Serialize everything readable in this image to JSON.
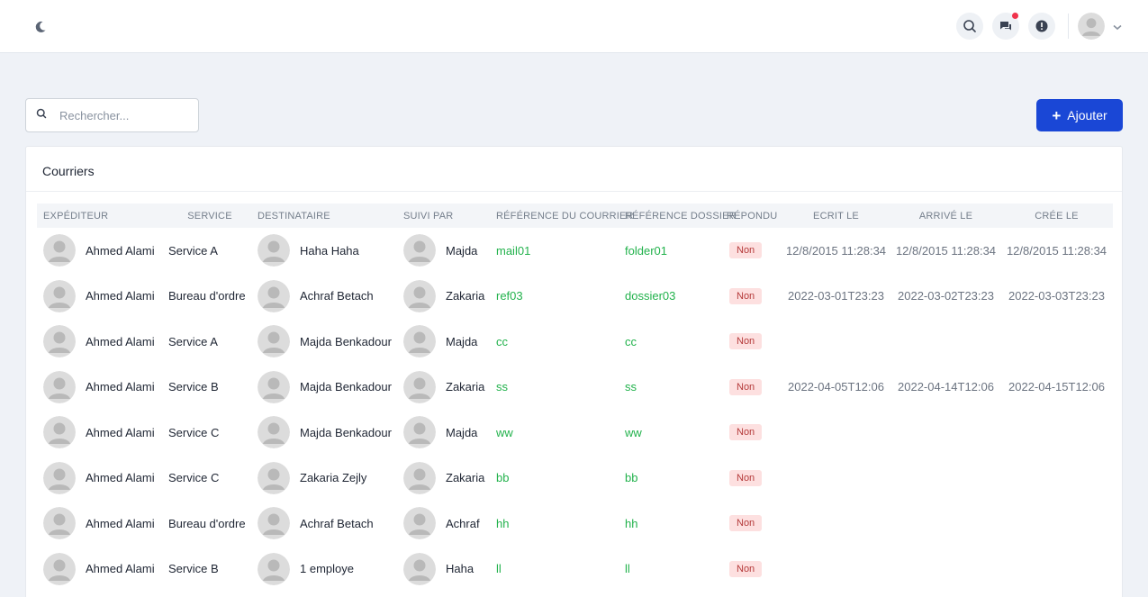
{
  "search": {
    "placeholder": "Rechercher..."
  },
  "add_button": {
    "label": "Ajouter"
  },
  "card": {
    "title": "Courriers"
  },
  "colors": {
    "accent": "#1a47d6",
    "link_green": "#22b24c",
    "badge_bg": "#fde0e0",
    "badge_text": "#b53b3b"
  },
  "table": {
    "headers": {
      "expediteur": "EXPÉDITEUR",
      "service": "SERVICE",
      "destinataire": "DESTINATAIRE",
      "suivi_par": "SUIVI PAR",
      "ref_courrier": "RÉFÉRENCE DU COURRIER",
      "ref_dossier": "RÉFÉRENCE DOSSIER",
      "repondu": "RÉPONDU",
      "ecrit_le": "ECRIT LE",
      "arrive_le": "ARRIVÉ LE",
      "cree_le": "CRÉE LE"
    },
    "rows": [
      {
        "expediteur": "Ahmed Alami",
        "service": "Service A",
        "destinataire": "Haha Haha",
        "suivi_par": "Majda",
        "ref_courrier": "mail01",
        "ref_dossier": "folder01",
        "repondu": "Non",
        "ecrit_le": "12/8/2015 11:28:34",
        "arrive_le": "12/8/2015 11:28:34",
        "cree_le": "12/8/2015 11:28:34"
      },
      {
        "expediteur": "Ahmed Alami",
        "service": "Bureau d'ordre",
        "destinataire": "Achraf Betach",
        "suivi_par": "Zakaria",
        "ref_courrier": "ref03",
        "ref_dossier": "dossier03",
        "repondu": "Non",
        "ecrit_le": "2022-03-01T23:23",
        "arrive_le": "2022-03-02T23:23",
        "cree_le": "2022-03-03T23:23"
      },
      {
        "expediteur": "Ahmed Alami",
        "service": "Service A",
        "destinataire": "Majda Benkadour",
        "suivi_par": "Majda",
        "ref_courrier": "cc",
        "ref_dossier": "cc",
        "repondu": "Non",
        "ecrit_le": "",
        "arrive_le": "",
        "cree_le": ""
      },
      {
        "expediteur": "Ahmed Alami",
        "service": "Service B",
        "destinataire": "Majda Benkadour",
        "suivi_par": "Zakaria",
        "ref_courrier": "ss",
        "ref_dossier": "ss",
        "repondu": "Non",
        "ecrit_le": "2022-04-05T12:06",
        "arrive_le": "2022-04-14T12:06",
        "cree_le": "2022-04-15T12:06"
      },
      {
        "expediteur": "Ahmed Alami",
        "service": "Service C",
        "destinataire": "Majda Benkadour",
        "suivi_par": "Majda",
        "ref_courrier": "ww",
        "ref_dossier": "ww",
        "repondu": "Non",
        "ecrit_le": "",
        "arrive_le": "",
        "cree_le": ""
      },
      {
        "expediteur": "Ahmed Alami",
        "service": "Service C",
        "destinataire": "Zakaria Zejly",
        "suivi_par": "Zakaria",
        "ref_courrier": "bb",
        "ref_dossier": "bb",
        "repondu": "Non",
        "ecrit_le": "",
        "arrive_le": "",
        "cree_le": ""
      },
      {
        "expediteur": "Ahmed Alami",
        "service": "Bureau d'ordre",
        "destinataire": "Achraf Betach",
        "suivi_par": "Achraf",
        "ref_courrier": "hh",
        "ref_dossier": "hh",
        "repondu": "Non",
        "ecrit_le": "",
        "arrive_le": "",
        "cree_le": ""
      },
      {
        "expediteur": "Ahmed Alami",
        "service": "Service B",
        "destinataire": "1 employe",
        "suivi_par": "Haha",
        "ref_courrier": "ll",
        "ref_dossier": "ll",
        "repondu": "Non",
        "ecrit_le": "",
        "arrive_le": "",
        "cree_le": ""
      }
    ]
  },
  "icons": {
    "theme": "moon-icon",
    "search": "search-icon",
    "messages": "chat-icon",
    "alerts": "alert-circle-icon",
    "user": "user-avatar-icon",
    "menu": "chevron-down-icon"
  }
}
